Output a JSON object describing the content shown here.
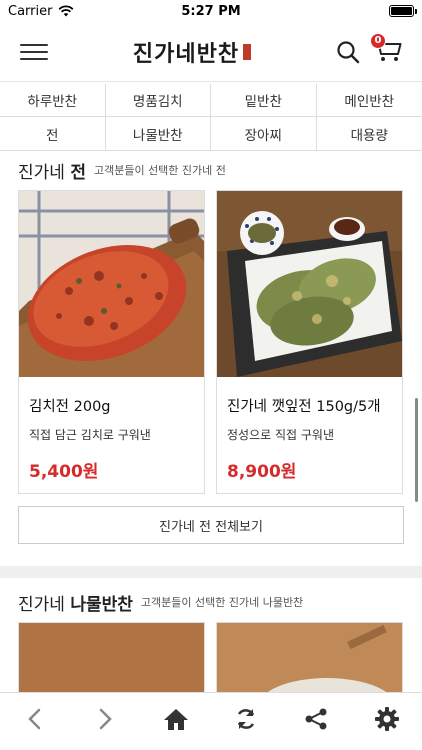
{
  "status_bar": {
    "carrier": "Carrier",
    "time": "5:27 PM"
  },
  "header": {
    "logo": "진가네반찬",
    "cart_count": "0"
  },
  "categories": [
    "하루반찬",
    "명품김치",
    "밑반찬",
    "메인반찬",
    "전",
    "나물반찬",
    "장아찌",
    "대용량"
  ],
  "section1": {
    "title_prefix": "진가네",
    "title_bold": "전",
    "subtitle": "고객분들이 선택한 진가네 전",
    "products": [
      {
        "name": "김치전 200g",
        "desc": "직접 담근 김치로 구워낸",
        "price": "5,400원"
      },
      {
        "name": "진가네 깻잎전 150g/5개",
        "desc": "정성으로 직접 구워낸",
        "price": "8,900원"
      }
    ],
    "view_all": "진가네 전 전체보기"
  },
  "section2": {
    "title_prefix": "진가네",
    "title_bold": "나물반찬",
    "subtitle": "고객분들이 선택한 진가네 나물반찬"
  },
  "bottom_nav": [
    "back-icon",
    "forward-icon",
    "home-icon",
    "refresh-icon",
    "share-icon",
    "settings-icon"
  ],
  "colors": {
    "price": "#d62b2b",
    "badge": "#d62b2b"
  }
}
